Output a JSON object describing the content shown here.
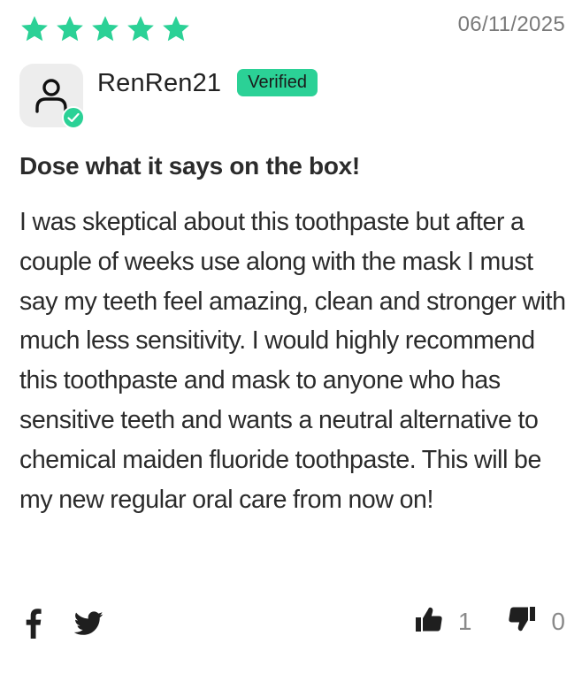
{
  "review": {
    "rating": 5,
    "rating_max": 5,
    "date": "06/11/2025",
    "author": {
      "name": "RenRen21",
      "badge": "Verified"
    },
    "title": "Dose what it says on the box!",
    "body": "I was skeptical about this toothpaste but after a couple of weeks use along with the mask I must say my teeth feel amazing, clean and stronger with much less sensitivity. I would highly recommend this toothpaste and mask to anyone who has sensitive teeth and wants a neutral alternative to chemical maiden fluoride toothpaste. This will be my new regular oral care from now on!",
    "helpful_yes": "1",
    "helpful_no": "0"
  },
  "icons": {
    "star": "star-icon",
    "avatar": "user-icon",
    "verified_check": "check-icon",
    "share_facebook": "facebook-icon",
    "share_twitter": "twitter-icon",
    "vote_up": "thumbs-up-icon",
    "vote_down": "thumbs-down-icon"
  },
  "colors": {
    "star": "#2bd196",
    "verified_badge": "#2bd196",
    "text": "#2b2b2b",
    "muted": "#7a7a7a"
  }
}
